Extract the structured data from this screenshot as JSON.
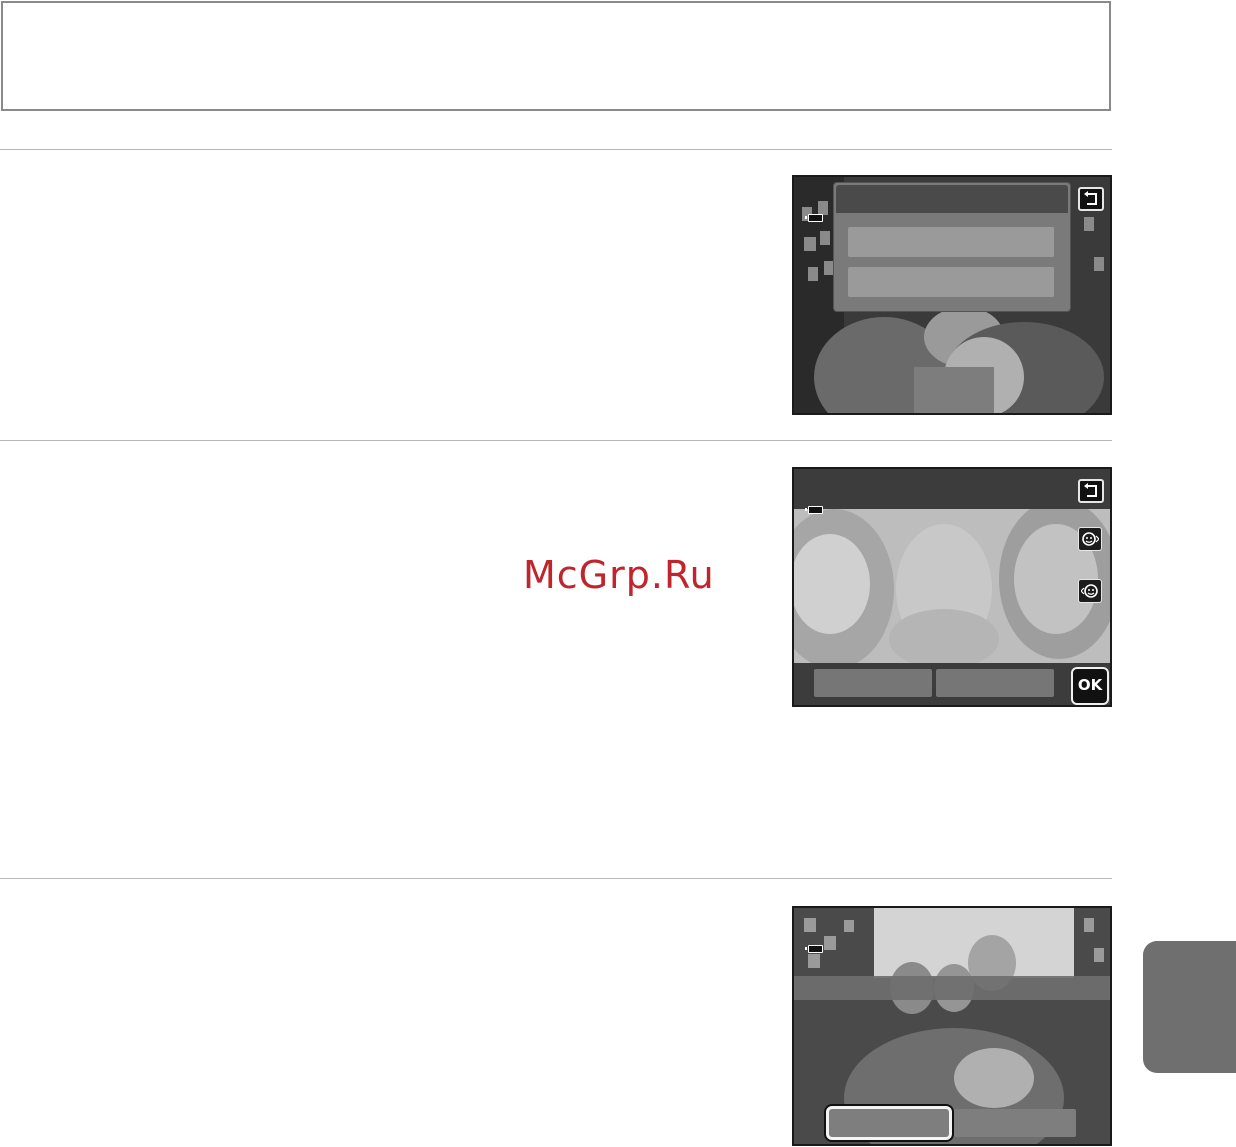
{
  "watermark": {
    "text": "McGrp.Ru"
  },
  "screens": [
    {
      "name": "menu-screen",
      "icons": [
        "battery-icon",
        "back-icon"
      ]
    },
    {
      "name": "face-select-screen",
      "icons": [
        "battery-icon",
        "back-icon",
        "face-next-icon",
        "face-prev-icon"
      ],
      "ok_label": "OK"
    },
    {
      "name": "confirm-screen",
      "icons": [
        "battery-icon"
      ]
    }
  ],
  "colors": {
    "side_tab": "#6f6f6f",
    "watermark": "#c0242c"
  }
}
